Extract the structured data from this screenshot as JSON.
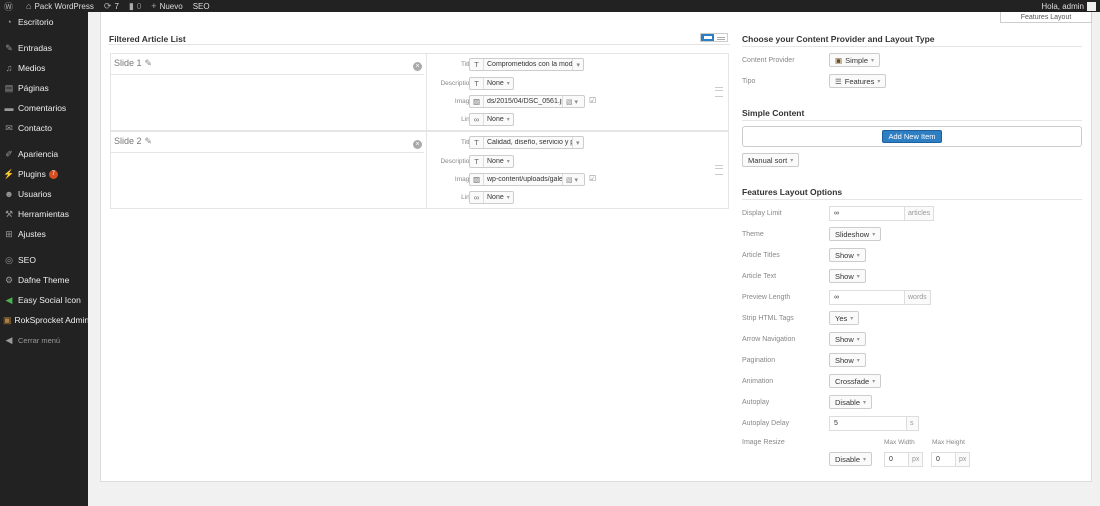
{
  "adminbar": {
    "site_name": "Pack WordPress",
    "updates_count": "7",
    "comments_count": "0",
    "new_label": "Nuevo",
    "seo_label": "SEO",
    "greeting": "Hola, admin"
  },
  "top_button": {
    "label": "Features Layout"
  },
  "sidebar": {
    "items": [
      {
        "label": "Escritorio"
      },
      {
        "label": "Entradas"
      },
      {
        "label": "Medios"
      },
      {
        "label": "Páginas"
      },
      {
        "label": "Comentarios"
      },
      {
        "label": "Contacto"
      },
      {
        "label": "Apariencia"
      },
      {
        "label": "Plugins",
        "badge": "7"
      },
      {
        "label": "Usuarios"
      },
      {
        "label": "Herramientas"
      },
      {
        "label": "Ajustes"
      },
      {
        "label": "SEO"
      },
      {
        "label": "Dafne Theme"
      },
      {
        "label": "Easy Social Icon"
      },
      {
        "label": "RokSprocket Admin"
      }
    ],
    "collapse_label": "Cerrar menú"
  },
  "article_list": {
    "title": "Filtered Article List",
    "field_labels": {
      "title": "Title",
      "description": "Description",
      "image": "Image",
      "link": "Link"
    },
    "slides": [
      {
        "name": "Slide 1",
        "title_value": "Comprometidos con la moda",
        "description_value": "None",
        "image_value": "ds/2015/04/DSC_0561.jpg",
        "link_value": "None"
      },
      {
        "name": "Slide 2",
        "title_value": "Calidad, diseño, servicio y prec",
        "description_value": "None",
        "image_value": "wp-content/uploads/galeria",
        "link_value": "None"
      }
    ]
  },
  "provider": {
    "title": "Choose your Content Provider and Layout Type",
    "content_provider_label": "Content Provider",
    "content_provider_value": "Simple",
    "tipo_label": "Tipo",
    "tipo_value": "Features"
  },
  "simple_content": {
    "title": "Simple Content",
    "add_new_label": "Add New Item",
    "sort_label": "Manual sort"
  },
  "layout_options": {
    "title": "Features Layout Options",
    "display_limit": {
      "label": "Display Limit",
      "value": "∞",
      "unit": "articles"
    },
    "theme": {
      "label": "Theme",
      "value": "Slideshow"
    },
    "article_titles": {
      "label": "Article Titles",
      "value": "Show"
    },
    "article_text": {
      "label": "Article Text",
      "value": "Show"
    },
    "preview_length": {
      "label": "Preview Length",
      "value": "∞",
      "unit": "words"
    },
    "strip_html": {
      "label": "Strip HTML Tags",
      "value": "Yes"
    },
    "arrow_navigation": {
      "label": "Arrow Navigation",
      "value": "Show"
    },
    "pagination": {
      "label": "Pagination",
      "value": "Show"
    },
    "animation": {
      "label": "Animation",
      "value": "Crossfade"
    },
    "autoplay": {
      "label": "Autoplay",
      "value": "Disable"
    },
    "autoplay_delay": {
      "label": "Autoplay Delay",
      "value": "5",
      "unit": "s"
    },
    "image_resize": {
      "label": "Image Resize",
      "value": "Disable",
      "max_width_label": "Max Width",
      "max_height_label": "Max Height",
      "max_width": "0",
      "max_height": "0",
      "unit": "px"
    }
  }
}
